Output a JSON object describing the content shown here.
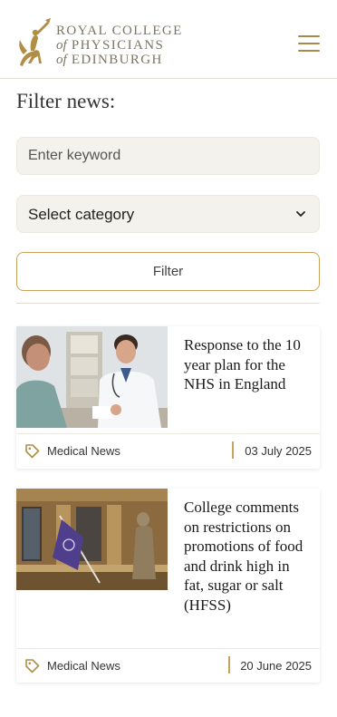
{
  "header": {
    "logo_line1": "ROYAL COLLEGE",
    "logo_line2_of": "of",
    "logo_line2": "PHYSICIANS",
    "logo_line3_of": "of",
    "logo_line3": "EDINBURGH",
    "menu_icon": "hamburger-menu-icon"
  },
  "filter": {
    "title": "Filter news:",
    "keyword_placeholder": "Enter keyword",
    "category_selected": "Select category",
    "button_label": "Filter"
  },
  "articles": [
    {
      "title": "Response to the 10 year plan for the NHS in England",
      "category": "Medical News",
      "date": "03 July 2025",
      "image": "doctor-consultation-photo"
    },
    {
      "title": "College comments on restrictions on promotions of food and drink high in fat, sugar or salt (HFSS)",
      "category": "Medical News",
      "date": "20 June 2025",
      "image": "college-building-flag-photo"
    }
  ],
  "colors": {
    "accent_gold": "#c9a35c",
    "logo_text": "#7d7563",
    "input_bg": "#f4f2ec"
  }
}
